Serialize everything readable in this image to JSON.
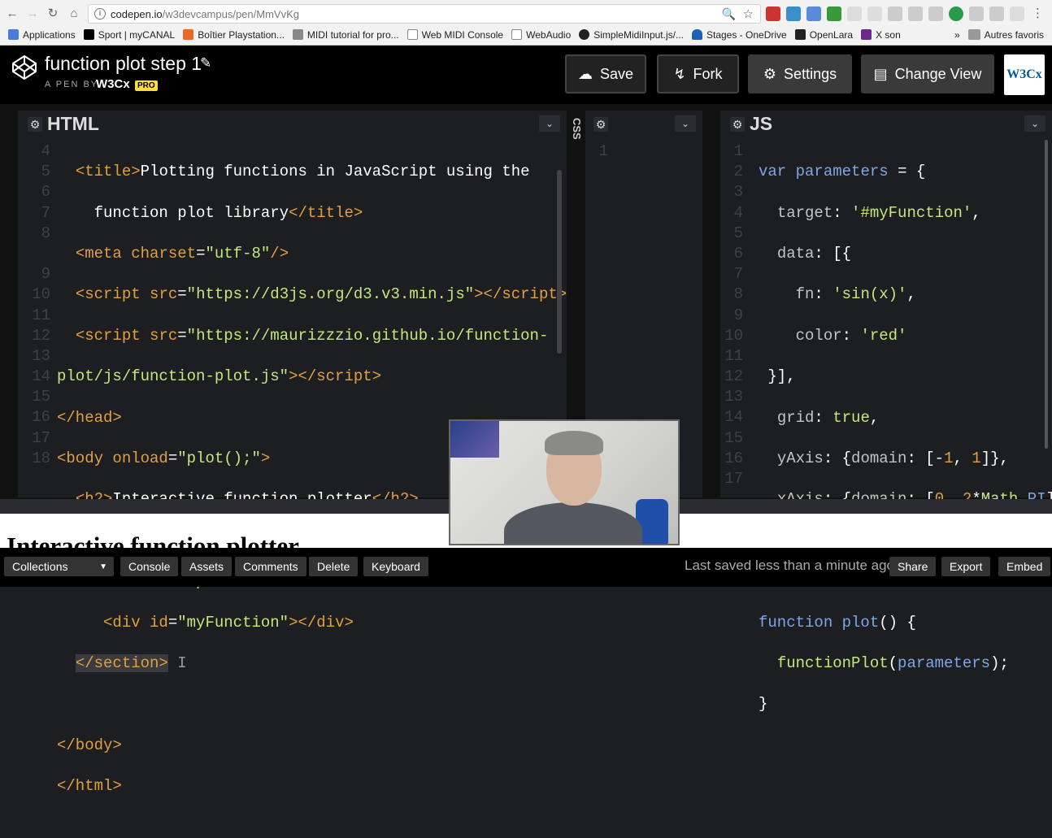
{
  "browser": {
    "url_host": "codepen.io",
    "url_path": "/w3devcampus/pen/MmVvKg",
    "bookmarks": [
      {
        "label": "Applications",
        "color": "#4a7bd8"
      },
      {
        "label": "Sport | myCANAL",
        "color": "#000000"
      },
      {
        "label": "Boîtier Playstation...",
        "color": "#e86a2a"
      },
      {
        "label": "MIDI tutorial for pro...",
        "color": "#555555"
      },
      {
        "label": "Web MIDI Console",
        "color": "#888888"
      },
      {
        "label": "WebAudio",
        "color": "#888888"
      },
      {
        "label": "SimpleMidiInput.js/...",
        "color": "#222222"
      },
      {
        "label": "Stages - OneDrive",
        "color": "#1e5fb8"
      },
      {
        "label": "OpenLara",
        "color": "#222222"
      },
      {
        "label": "X son",
        "color": "#6a2a8a"
      }
    ],
    "bookmarks_more": "»",
    "other_bookmarks": "Autres favoris"
  },
  "codepen": {
    "pen_title": "function plot step 1",
    "pen_by": "A PEN BY",
    "author": "W3Cx",
    "pro_badge": "PRO",
    "buttons": {
      "save": "Save",
      "fork": "Fork",
      "settings": "Settings",
      "change_view": "Change View"
    },
    "avatar_text": "W3Cx"
  },
  "editors": {
    "html_title": "HTML",
    "css_title": "CSS",
    "js_title": "JS",
    "html_line_numbers": [
      "4",
      "5",
      "6",
      "7",
      "8",
      "",
      "9",
      "10",
      "11",
      "12",
      "13",
      "14",
      "15",
      "16",
      "17",
      "18"
    ],
    "css_line_numbers": [
      "1"
    ],
    "js_line_numbers": [
      "1",
      "2",
      "3",
      "4",
      "5",
      "6",
      "7",
      "8",
      "9",
      "10",
      "11",
      "12",
      "13",
      "14",
      "15",
      "16",
      "17"
    ]
  },
  "preview": {
    "heading": "Interactive function plotter"
  },
  "footer": {
    "collections": "Collections",
    "console": "Console",
    "assets": "Assets",
    "comments": "Comments",
    "delete": "Delete",
    "keyboard": "Keyboard",
    "saved_status": "Last saved less than a minute ago",
    "share": "Share",
    "export": "Export",
    "embed": "Embed"
  },
  "colors": {
    "editor_bg": "#1d1e22",
    "tag": "#e2a03e",
    "string": "#c4e87b",
    "keyword": "#7ea6e6",
    "pro_badge": "#ffdd40"
  }
}
